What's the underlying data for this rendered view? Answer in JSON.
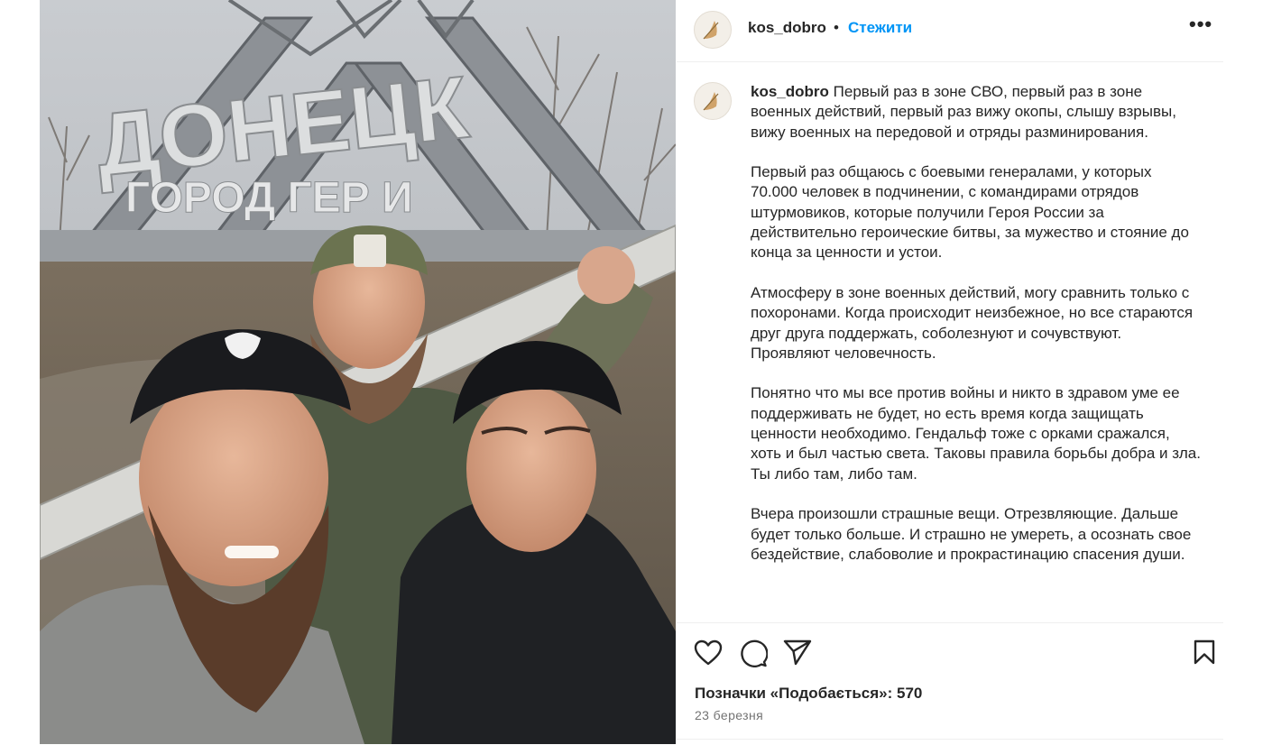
{
  "post": {
    "username": "kos_dobro",
    "separator": "•",
    "follow_label": "Стежити",
    "more_label": "•••",
    "sign_text": {
      "city": "ДОНЕЦК",
      "subtitle": "ГОРОД ГЕР И"
    },
    "caption": {
      "username": "kos_dobro",
      "paragraphs": [
        "Первый раз в зоне СВО, первый раз в зоне военных действий, первый раз вижу окопы, слышу взрывы, вижу военных на передовой и отряды разминирования.",
        "Первый раз общаюсь с боевыми генералами, у которых 70.000 человек в подчинении, с командирами отрядов штурмовиков, которые получили Героя России за действительно героические битвы, за мужество и стояние до конца за ценности и устои.",
        "Атмосферу в зоне военных действий, могу сравнить только с похоронами. Когда происходит неизбежное, но все стараются друг друга поддержать, соболезнуют и сочувствуют. Проявляют человечность.",
        "Понятно что мы все против войны и никто в здравом уме ее поддерживать не будет, но есть время когда защищать ценности необходимо. Гендальф тоже с орками сражался, хоть и был частью света. Таковы правила борьбы добра и зла. Ты либо там, либо там.",
        "Вчера произошли страшные вещи. Отрезвляющие. Дальше будет только больше. И страшно не умереть, а осознать свое бездействие, слабоволие и прокрастинацию спасения души."
      ]
    },
    "likes_text": "Позначки «Подобається»: 570",
    "date": "23 березня"
  },
  "icons": {
    "like": "heart-icon",
    "comment": "comment-bubble-icon",
    "share": "paper-plane-icon",
    "save": "bookmark-icon"
  },
  "colors": {
    "link": "#0095f6",
    "text": "#262626",
    "muted": "#737373",
    "divider": "#efefef"
  }
}
